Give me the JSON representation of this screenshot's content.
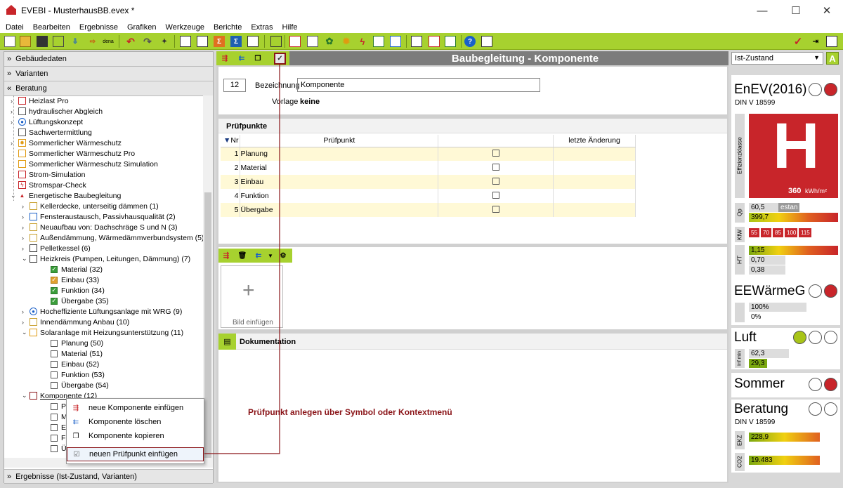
{
  "window": {
    "title": "EVEBI - MusterhausBB.evex *",
    "minimize": "—",
    "maximize": "☐",
    "close": "✕"
  },
  "menu": [
    "Datei",
    "Bearbeiten",
    "Ergebnisse",
    "Grafiken",
    "Werkzeuge",
    "Berichte",
    "Extras",
    "Hilfe"
  ],
  "toolbar": {
    "dena_label": "dena"
  },
  "left": {
    "sections": {
      "gebaeude": "Gebäudedaten",
      "varianten": "Varianten",
      "beratung": "Beratung",
      "ergebnisse": "Ergebnisse (Ist-Zustand, Varianten)"
    },
    "tree": [
      "Heizlast Pro",
      "hydraulischer Abgleich",
      "Lüftungskonzept",
      "Sachwertermittlung",
      "Sommerlicher Wärmeschutz",
      "Sommerlicher Wärmeschutz Pro",
      "Sommerlicher Wärmeschutz Simulation",
      "Strom-Simulation",
      "Stromspar-Check",
      "Energetische Baubegleitung",
      "Kellerdecke, unterseitig dämmen (1)",
      "Fensteraustausch, Passivhausqualität (2)",
      "Neuaufbau von: Dachschräge S und N (3)",
      "Außendämmung, Wärmedämmverbundsystem (5)",
      "Pelletkessel (6)",
      "Heizkreis (Pumpen, Leitungen, Dämmung) (7)",
      "Material (32)",
      "Einbau (33)",
      "Funktion (34)",
      "Übergabe (35)",
      "Hocheffiziente Lüftungsanlage mit WRG (9)",
      "Innendämmung Anbau (10)",
      "Solaranlage mit Heizungsunterstützung (11)",
      "Planung (50)",
      "Material (51)",
      "Einbau (52)",
      "Funktion (53)",
      "Übergabe (54)",
      "Komponente (12)",
      "Pla",
      "Ma",
      "Ein",
      "Fu",
      "Üb"
    ]
  },
  "context_menu": [
    "neue Komponente einfügen",
    "Komponente löschen",
    "Komponente kopieren",
    "neuen Prüfpunkt einfügen"
  ],
  "center": {
    "title": "Baubegleitung - Komponente",
    "id_value": "12",
    "bezeichnung_label": "Bezeichnung",
    "bezeichnung_value": "Komponente",
    "vorlage_label": "Vorlage",
    "vorlage_value": "keine",
    "pruef_title": "Prüfpunkte",
    "col_nr": "Nr",
    "col_pruefpunkt": "Prüfpunkt",
    "col_letzte": "letzte Änderung",
    "rows": [
      {
        "nr": "1",
        "name": "Planung"
      },
      {
        "nr": "2",
        "name": "Material"
      },
      {
        "nr": "3",
        "name": "Einbau"
      },
      {
        "nr": "4",
        "name": "Funktion"
      },
      {
        "nr": "5",
        "name": "Übergabe"
      }
    ],
    "bild_label": "Bild einfügen",
    "doku_label": "Dokumentation"
  },
  "annotation": "Prüfpunkt anlegen über Symbol oder Kontextmenü",
  "right": {
    "select": "Ist-Zustand",
    "enev": "EnEV(2016)",
    "din": "DIN V 18599",
    "effizienz": "Effizienzklasse",
    "klasse": "H",
    "kwh_value": "360",
    "kwh_unit": "kWh/m²",
    "qp_label": "Qp",
    "qp1": "60,5",
    "qp_tag": "estan",
    "qp2": "399,7",
    "kfw_label": "KfW",
    "kfw": [
      "55",
      "70",
      "85",
      "100",
      "115"
    ],
    "ht_label": "H'T",
    "ht1": "1,15",
    "ht2": "0,70",
    "ht3": "0,38",
    "eew": "EEWärmeG",
    "eew1": "100%",
    "eew2": "0%",
    "luft": "Luft",
    "luft_label": "Inf min",
    "luft1": "62,3",
    "luft2": "29,3",
    "sommer": "Sommer",
    "beratung": "Beratung",
    "din2": "DIN V 18599",
    "ekz_label": "EKZ",
    "ekz": "228,9",
    "co2_label": "CO2",
    "co2": "19.483"
  },
  "colors": {
    "accent": "#a7d12f",
    "header": "#7c7c7c",
    "red": "#c8252a",
    "annotation": "#8a1418"
  }
}
